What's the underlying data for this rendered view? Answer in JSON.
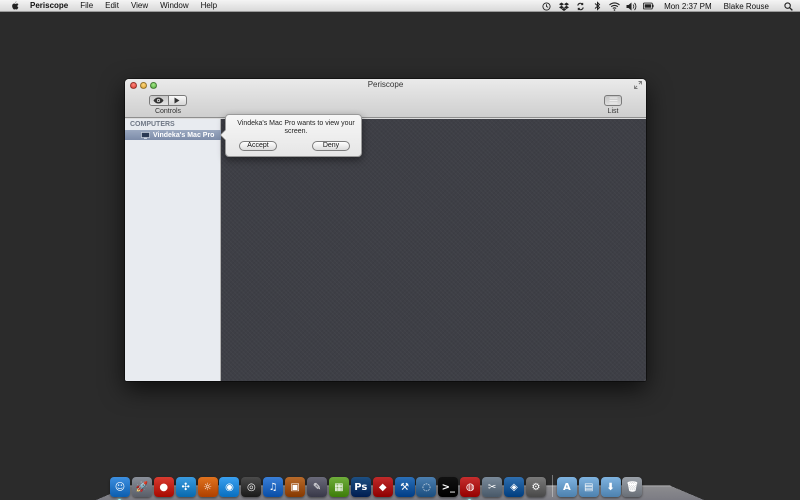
{
  "menubar": {
    "app_name": "Periscope",
    "menus": [
      "File",
      "Edit",
      "View",
      "Window",
      "Help"
    ],
    "status_icons": [
      "time-machine-icon",
      "dropbox-icon",
      "sync-icon",
      "bluetooth-icon",
      "wifi-icon",
      "volume-icon",
      "battery-icon"
    ],
    "clock": "Mon 2:37 PM",
    "user": "Blake Rouse",
    "search_icon": "spotlight-search-icon"
  },
  "window": {
    "title": "Periscope",
    "toolbar": {
      "controls_label": "Controls",
      "list_label": "List"
    },
    "sidebar": {
      "header": "COMPUTERS",
      "items": [
        {
          "label": "Vindeka's Mac Pro",
          "selected": true
        }
      ]
    },
    "popover": {
      "message": "Vindeka's Mac Pro wants to view your screen.",
      "accept_label": "Accept",
      "deny_label": "Deny"
    }
  },
  "dock": {
    "apps": [
      {
        "name": "finder",
        "glyph": "☺",
        "color": "#3d8fe0"
      },
      {
        "name": "launchpad",
        "glyph": "🚀",
        "color": "#8a8f99"
      },
      {
        "name": "chrome",
        "glyph": "●",
        "color": "#d93b30"
      },
      {
        "name": "safari",
        "glyph": "✣",
        "color": "#3a9be0"
      },
      {
        "name": "firefox",
        "glyph": "☼",
        "color": "#e0721e"
      },
      {
        "name": "facetime",
        "glyph": "◉",
        "color": "#3aa0f0"
      },
      {
        "name": "camera",
        "glyph": "◎",
        "color": "#4b4b4b"
      },
      {
        "name": "itunes",
        "glyph": "♫",
        "color": "#3a7fd8"
      },
      {
        "name": "app",
        "glyph": "▣",
        "color": "#b86a2a"
      },
      {
        "name": "pencil-app",
        "glyph": "✎",
        "color": "#6a6a7a"
      },
      {
        "name": "charts-app",
        "glyph": "▦",
        "color": "#6fae3b"
      },
      {
        "name": "photoshop",
        "glyph": "Ps",
        "color": "#1d4f82"
      },
      {
        "name": "pdf-app",
        "glyph": "◆",
        "color": "#c02a2a"
      },
      {
        "name": "xcode",
        "glyph": "⚒",
        "color": "#2a6fb8"
      },
      {
        "name": "network-app",
        "glyph": "◌",
        "color": "#4c7fb0"
      },
      {
        "name": "terminal",
        "glyph": ">_",
        "color": "#111111"
      },
      {
        "name": "periscope",
        "glyph": "◍",
        "color": "#c62e2e"
      },
      {
        "name": "tools-app",
        "glyph": "✂",
        "color": "#7a8a9a"
      },
      {
        "name": "virtualbox",
        "glyph": "◈",
        "color": "#2f6fb0"
      },
      {
        "name": "system-app",
        "glyph": "⚙",
        "color": "#7a7a7a"
      }
    ],
    "stacks": [
      {
        "name": "applications-folder",
        "glyph": "A",
        "color": "#7fb3e0"
      },
      {
        "name": "documents-folder",
        "glyph": "▤",
        "color": "#7fb3e0"
      },
      {
        "name": "downloads-folder",
        "glyph": "⬇",
        "color": "#7fb3e0"
      },
      {
        "name": "trash",
        "glyph": "🗑",
        "color": "#9aa0a8"
      }
    ]
  }
}
